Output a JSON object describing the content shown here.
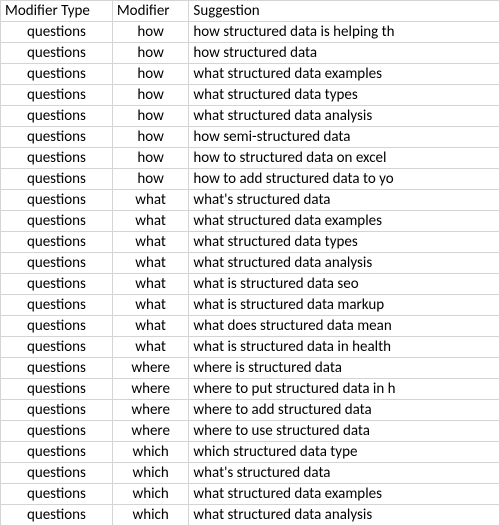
{
  "headers": [
    "Modifier Type",
    "Modifier",
    "Suggestion"
  ],
  "rows": [
    {
      "type": "questions",
      "mod": "how",
      "sugg": "how structured data is helping th"
    },
    {
      "type": "questions",
      "mod": "how",
      "sugg": "how structured data"
    },
    {
      "type": "questions",
      "mod": "how",
      "sugg": "what structured data examples"
    },
    {
      "type": "questions",
      "mod": "how",
      "sugg": "what structured data types"
    },
    {
      "type": "questions",
      "mod": "how",
      "sugg": "what structured data analysis"
    },
    {
      "type": "questions",
      "mod": "how",
      "sugg": "how semi-structured data"
    },
    {
      "type": "questions",
      "mod": "how",
      "sugg": "how to structured data on excel"
    },
    {
      "type": "questions",
      "mod": "how",
      "sugg": "how to add structured data to yo"
    },
    {
      "type": "questions",
      "mod": "what",
      "sugg": "what's structured data"
    },
    {
      "type": "questions",
      "mod": "what",
      "sugg": "what structured data examples"
    },
    {
      "type": "questions",
      "mod": "what",
      "sugg": "what structured data types"
    },
    {
      "type": "questions",
      "mod": "what",
      "sugg": "what structured data analysis"
    },
    {
      "type": "questions",
      "mod": "what",
      "sugg": "what is structured data seo"
    },
    {
      "type": "questions",
      "mod": "what",
      "sugg": "what is structured data markup"
    },
    {
      "type": "questions",
      "mod": "what",
      "sugg": "what does structured data mean"
    },
    {
      "type": "questions",
      "mod": "what",
      "sugg": "what is structured data in health"
    },
    {
      "type": "questions",
      "mod": "where",
      "sugg": "where is structured data"
    },
    {
      "type": "questions",
      "mod": "where",
      "sugg": "where to put structured data in h"
    },
    {
      "type": "questions",
      "mod": "where",
      "sugg": "where to add structured data"
    },
    {
      "type": "questions",
      "mod": "where",
      "sugg": "where to use structured data"
    },
    {
      "type": "questions",
      "mod": "which",
      "sugg": "which structured data type"
    },
    {
      "type": "questions",
      "mod": "which",
      "sugg": "what's structured data"
    },
    {
      "type": "questions",
      "mod": "which",
      "sugg": "what structured data examples"
    },
    {
      "type": "questions",
      "mod": "which",
      "sugg": "what structured data analysis"
    }
  ]
}
